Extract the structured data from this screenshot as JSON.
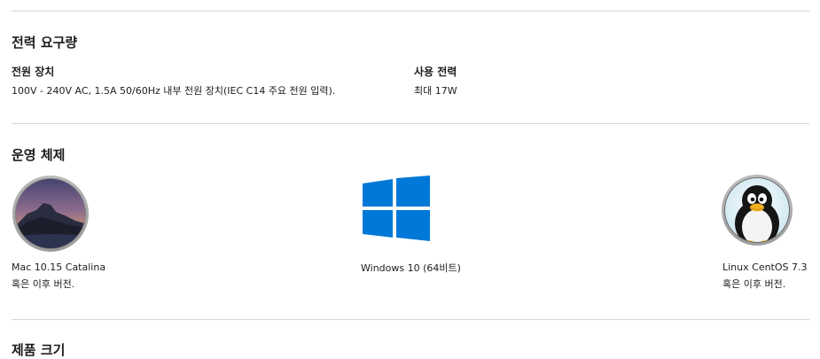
{
  "power": {
    "title": "전력 요구량",
    "supply_label": "전원 장치",
    "supply_value": "100V - 240V AC, 1.5A 50/60Hz 내부 전원 장치(IEC C14 주요 전원 입력).",
    "usage_label": "사용 전력",
    "usage_value": "최대 17W"
  },
  "os": {
    "title": "운영 체제",
    "items": [
      {
        "name": "Mac 10.15 Catalina",
        "note": "혹은 이후 버전.",
        "icon": "macos-catalina-icon"
      },
      {
        "name": "Windows 10 (64비트)",
        "note": "",
        "icon": "windows-logo-icon"
      },
      {
        "name": "Linux CentOS 7.3",
        "note": "혹은 이후 버전.",
        "icon": "linux-tux-icon"
      }
    ]
  },
  "size": {
    "title": "제품 크기"
  },
  "colors": {
    "windows_blue": "#0078d7",
    "divider": "#d6d6d6",
    "text": "#1d1d1f"
  }
}
